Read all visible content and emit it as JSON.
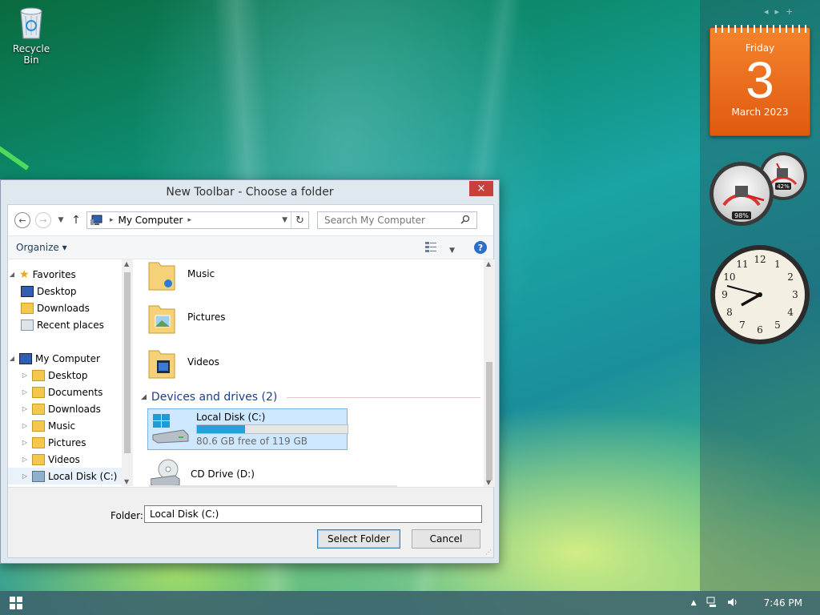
{
  "desktop": {
    "icons": [
      {
        "label": "Recycle Bin",
        "icon": "recycle-bin-icon"
      }
    ]
  },
  "sidebar": {
    "calendar": {
      "weekday": "Friday",
      "day": "3",
      "month_year": "March 2023"
    },
    "cpu_meter": {
      "cpu_percent": "98%",
      "memory_percent": "42%"
    },
    "clock": {
      "numerals": [
        "12",
        "1",
        "2",
        "3",
        "4",
        "5",
        "6",
        "7",
        "8",
        "9",
        "10",
        "11"
      ]
    }
  },
  "dialog": {
    "title": "New Toolbar - Choose a folder",
    "close_icon": "×",
    "address": {
      "location": "My Computer",
      "refresh_icon": "↻"
    },
    "search": {
      "placeholder": "Search My Computer"
    },
    "toolbar": {
      "organize_label": "Organize ▾",
      "help_label": "?"
    },
    "navigation": {
      "favorites_header": "Favorites",
      "favorites": [
        "Desktop",
        "Downloads",
        "Recent places"
      ],
      "computer_header": "My Computer",
      "computer_items": [
        "Desktop",
        "Documents",
        "Downloads",
        "Music",
        "Pictures",
        "Videos",
        "Local Disk (C:)"
      ],
      "selected": "Local Disk (C:)"
    },
    "content": {
      "folders": [
        "Music",
        "Pictures",
        "Videos"
      ],
      "devices_group": "Devices and drives (2)",
      "drives": [
        {
          "name": "Local Disk (C:)",
          "free_text": "80.6 GB free of 119 GB",
          "used_fraction": 0.32
        },
        {
          "name": "CD Drive (D:)"
        }
      ]
    },
    "footer": {
      "folder_label": "Folder:",
      "folder_value": "Local Disk (C:)",
      "select_button": "Select Folder",
      "cancel_button": "Cancel"
    }
  },
  "taskbar": {
    "time": "7:46 PM",
    "tray_icons": [
      "show-hidden-icons",
      "network-icon",
      "volume-icon"
    ]
  },
  "colors": {
    "accent": "#26a0da",
    "close": "#c9403a",
    "calendar": "#f07a22"
  }
}
